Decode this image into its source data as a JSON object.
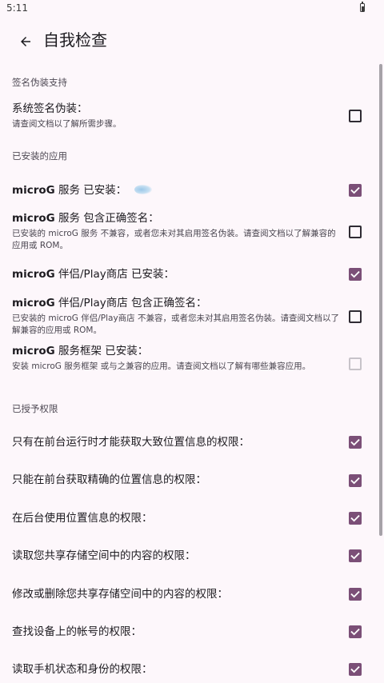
{
  "status_bar": {
    "time": "5:11"
  },
  "app_bar": {
    "title": "自我检查",
    "back_icon": "arrow-back-icon"
  },
  "sections": {
    "signature": {
      "header": "签名伪装支持",
      "items": [
        {
          "title": "系统签名伪装：",
          "summary": "请查阅文档以了解所需步骤。",
          "state": "unchecked"
        }
      ]
    },
    "installed": {
      "header": "已安装的应用",
      "items": [
        {
          "title_bold": "microG",
          "title_rest": " 服务 已安装：",
          "summary": "",
          "state": "checked"
        },
        {
          "title_bold": "microG",
          "title_rest": " 服务 包含正确签名：",
          "summary": "已安装的 microG 服务 不兼容，或者您未对其启用签名伪装。请查阅文档以了解兼容的应用或 ROM。",
          "state": "unchecked"
        },
        {
          "title_bold": "microG",
          "title_rest": " 伴侣/Play商店 已安装：",
          "summary": "",
          "state": "checked"
        },
        {
          "title_bold": "microG",
          "title_rest": " 伴侣/Play商店 包含正确签名：",
          "summary": "已安装的 microG 伴侣/Play商店 不兼容，或者您未对其启用签名伪装。请查阅文档以了解兼容的应用或 ROM。",
          "state": "unchecked"
        },
        {
          "title_bold": "microG",
          "title_rest": " 服务框架 已安装：",
          "summary": "安装 microG 服务框架 或与之兼容的应用。请查阅文档以了解有哪些兼容应用。",
          "state": "disabled"
        }
      ]
    },
    "permissions": {
      "header": "已授予权限",
      "items": [
        {
          "title": "只有在前台运行时才能获取大致位置信息的权限：",
          "state": "checked"
        },
        {
          "title": "只能在前台获取精确的位置信息的权限：",
          "state": "checked"
        },
        {
          "title": "在后台使用位置信息的权限：",
          "state": "checked"
        },
        {
          "title": "读取您共享存储空间中的内容的权限：",
          "state": "checked"
        },
        {
          "title": "修改或删除您共享存储空间中的内容的权限：",
          "state": "checked"
        },
        {
          "title": "查找设备上的帐号的权限：",
          "state": "checked"
        },
        {
          "title": "读取手机状态和身份的权限：",
          "state": "checked"
        }
      ]
    }
  },
  "colors": {
    "background": "#fdf7fb",
    "checkbox_checked": "#7b4f77",
    "text_primary": "#1d1b20",
    "text_secondary": "#49454f"
  }
}
